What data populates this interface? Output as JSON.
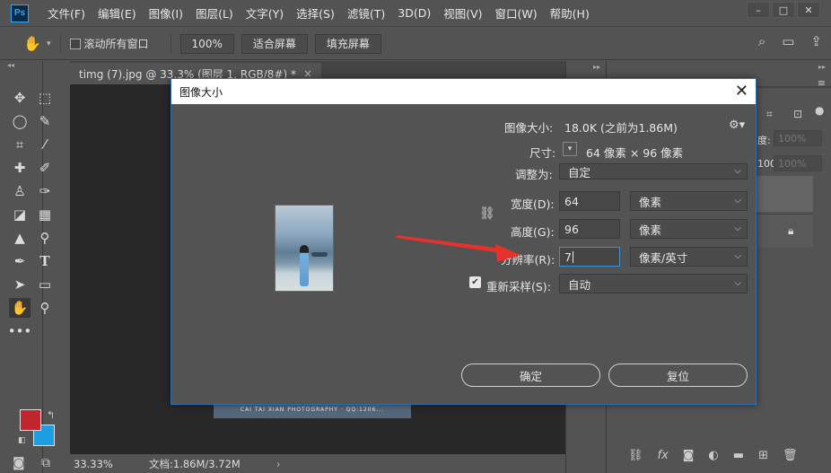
{
  "menubar": {
    "logo": "Ps",
    "items": [
      "文件(F)",
      "编辑(E)",
      "图像(I)",
      "图层(L)",
      "文字(Y)",
      "选择(S)",
      "滤镜(T)",
      "3D(D)",
      "视图(V)",
      "窗口(W)",
      "帮助(H)"
    ],
    "window_controls": [
      "–",
      "□",
      "✕"
    ]
  },
  "options": {
    "scroll_all_windows": "滚动所有窗口",
    "zoom_100": "100%",
    "fit_screen": "适合屏幕",
    "fill_screen": "填充屏幕"
  },
  "document": {
    "tab_title": "timg (7).jpg @ 33.3% (图层 1, RGB/8#) *",
    "tab_close": "×",
    "strip_text": "CAI TAI XIAN PHOTOGRAPHY · QQ:1206...",
    "zoom": "33.33%",
    "doc_info": "文档:1.86M/3.72M",
    "status_arrow": "›"
  },
  "right_panel": {
    "opacity": "100%",
    "fill": "100%",
    "frag1": "度:",
    "frag2": "充:"
  },
  "dialog": {
    "title": "图像大小",
    "image_size_label": "图像大小:",
    "image_size_value": "18.0K (之前为1.86M)",
    "dimensions_label": "尺寸:",
    "dimensions_value": "64 像素  ×  96 像素",
    "fit_to_label": "调整为:",
    "fit_to_value": "自定",
    "width_label": "宽度(D):",
    "width_value": "64",
    "width_unit": "像素",
    "height_label": "高度(G):",
    "height_value": "96",
    "height_unit": "像素",
    "resolution_label": "分辨率(R):",
    "resolution_value": "7",
    "resolution_unit": "像素/英寸",
    "resample_label": "重新采样(S):",
    "resample_value": "自动",
    "ok_button": "确定",
    "reset_button": "复位"
  },
  "colors": {
    "foreground": "#c1262e",
    "background": "#1f9de3",
    "accent": "#3d8fd6",
    "arrow": "#e8312a"
  }
}
